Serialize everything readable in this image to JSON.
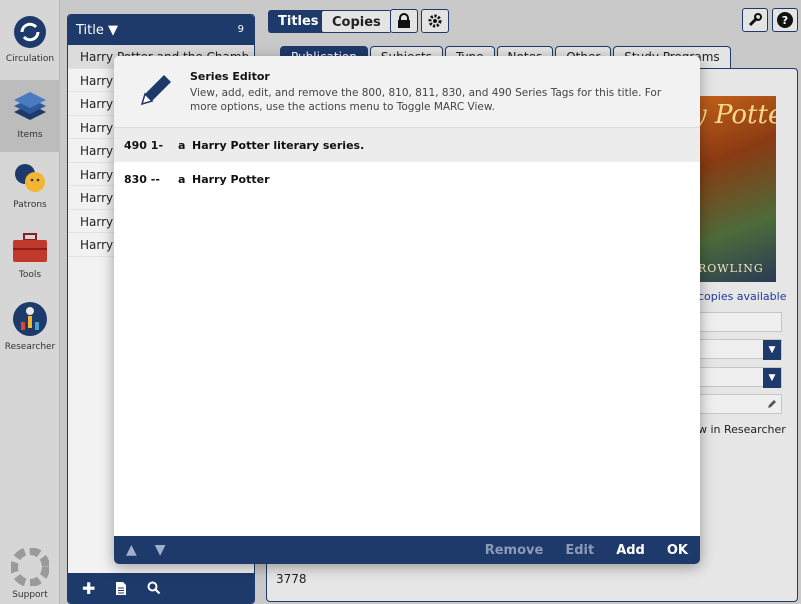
{
  "sidebar": {
    "items": [
      {
        "label": "Circulation"
      },
      {
        "label": "Items"
      },
      {
        "label": "Patrons"
      },
      {
        "label": "Tools"
      },
      {
        "label": "Researcher"
      },
      {
        "label": "Support"
      }
    ]
  },
  "title_list": {
    "header": "Title",
    "count": "9",
    "rows": [
      "Harry Potter and the Chamb",
      "Harry I",
      "Harry I",
      "Harry I",
      "Harry I",
      "Harry I",
      "Harry I",
      "Harry I",
      "Harry I"
    ]
  },
  "top_tabs": {
    "titles": "Titles",
    "copies": "Copies"
  },
  "sub_tabs": [
    "Publication",
    "Subjects",
    "Type",
    "Notes",
    "Other",
    "Study Programs"
  ],
  "detail": {
    "cover_title": "y Potter",
    "cover_author": "ROWLING",
    "copies_available": "copies available",
    "view_in_researcher": "w in Researcher",
    "bottom_value": "3778"
  },
  "modal": {
    "title": "Series Editor",
    "description": "View, add, edit, and remove the 800, 810, 811, 830, and 490 Series Tags for this title. For more options, use the actions menu to Toggle MARC View.",
    "tags": [
      {
        "code": "490 1-",
        "subfield": "a",
        "value": "Harry Potter literary series."
      },
      {
        "code": "830 --",
        "subfield": "a",
        "value": "Harry Potter"
      }
    ],
    "buttons": {
      "remove": "Remove",
      "edit": "Edit",
      "add": "Add",
      "ok": "OK"
    }
  },
  "colors": {
    "navy": "#1e3a6b",
    "background": "#c9c9c9"
  }
}
